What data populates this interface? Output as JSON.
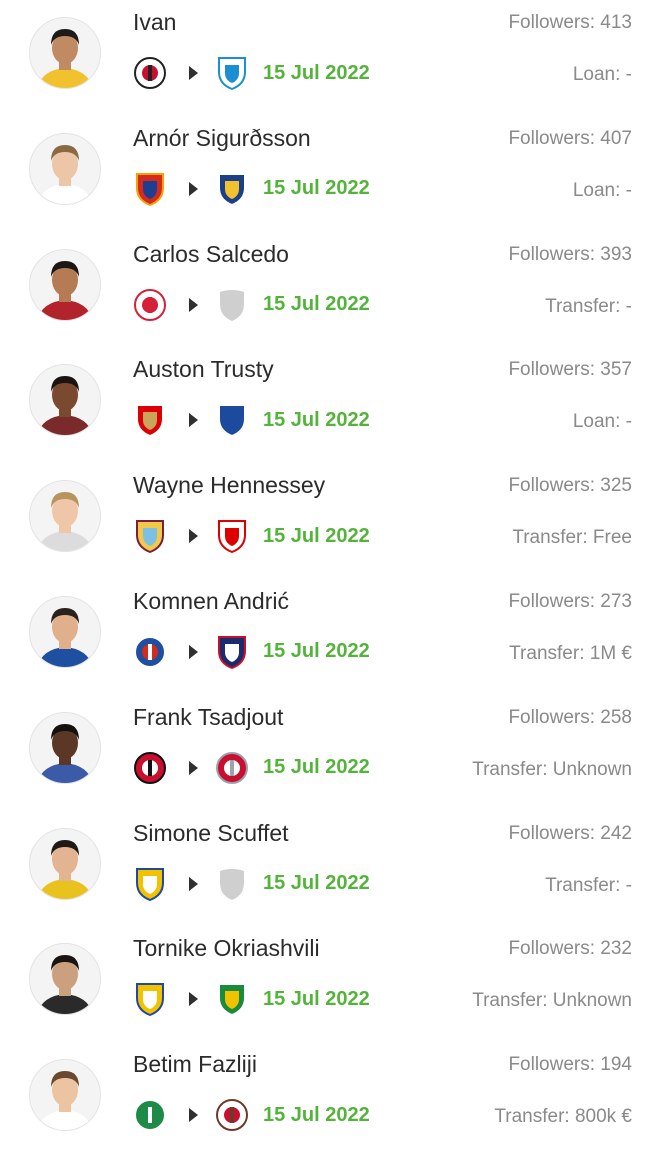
{
  "transfers": [
    {
      "name": "Ivan",
      "followers": "Followers: 413",
      "date": "15 Jul 2022",
      "deal": "Loan: -",
      "skin": "#c08a62",
      "hair": "#1d1a18",
      "shirt": "#f2c12e",
      "from_club": {
        "icon": "corinthians-crest-icon",
        "c1": "#ffffff",
        "c2": "#222222",
        "c3": "#c8102e"
      },
      "to_club": {
        "icon": "zenit-crest-icon",
        "c1": "#ffffff",
        "c2": "#1b8fd3",
        "c3": "#1b8fd3"
      }
    },
    {
      "name": "Arnór Sigurðsson",
      "followers": "Followers: 407",
      "date": "15 Jul 2022",
      "deal": "Loan: -",
      "skin": "#ecc6a6",
      "hair": "#8a6a45",
      "shirt": "#ffffff",
      "from_club": {
        "icon": "cska-crest-icon",
        "c1": "#d52b1e",
        "c2": "#f4a300",
        "c3": "#1e3f8f"
      },
      "to_club": {
        "icon": "norrkoping-crest-icon",
        "c1": "#1c3f8a",
        "c2": "#ffffff",
        "c3": "#f2c12e"
      }
    },
    {
      "name": "Carlos Salcedo",
      "followers": "Followers: 393",
      "date": "15 Jul 2022",
      "deal": "Transfer: -",
      "skin": "#b57b55",
      "hair": "#1a1716",
      "shirt": "#b3232b",
      "from_club": {
        "icon": "toronto-crest-icon",
        "c1": "#ffffff",
        "c2": "#d5203a",
        "c3": "#d5203a"
      },
      "to_club": {
        "icon": "placeholder-shield-icon",
        "c1": "#cfcfcf",
        "c2": "#cfcfcf",
        "c3": "#cfcfcf"
      }
    },
    {
      "name": "Auston Trusty",
      "followers": "Followers: 357",
      "date": "15 Jul 2022",
      "deal": "Loan: -",
      "skin": "#7a4a30",
      "hair": "#1a1512",
      "shirt": "#7a2a2a",
      "from_club": {
        "icon": "arsenal-crest-icon",
        "c1": "#db0007",
        "c2": "#ffffff",
        "c3": "#c9a55a"
      },
      "to_club": {
        "icon": "birmingham-crest-icon",
        "c1": "#1c4a9c",
        "c2": "#ffffff",
        "c3": "#1c4a9c"
      }
    },
    {
      "name": "Wayne Hennessey",
      "followers": "Followers: 325",
      "date": "15 Jul 2022",
      "deal": "Transfer: Free",
      "skin": "#efc7a8",
      "hair": "#b7935e",
      "shirt": "#dcdcdc",
      "from_club": {
        "icon": "burnley-crest-icon",
        "c1": "#f3c94a",
        "c2": "#7a1f3a",
        "c3": "#7dc0e4"
      },
      "to_club": {
        "icon": "nottingham-forest-crest-icon",
        "c1": "#ffffff",
        "c2": "#dd0000",
        "c3": "#dd0000"
      }
    },
    {
      "name": "Komnen Andrić",
      "followers": "Followers: 273",
      "date": "15 Jul 2022",
      "deal": "Transfer: 1M €",
      "skin": "#e0b08c",
      "hair": "#2a221d",
      "shirt": "#1f4fa0",
      "from_club": {
        "icon": "dinamo-zagreb-crest-icon",
        "c1": "#1f4fa0",
        "c2": "#ffffff",
        "c3": "#d52b1e"
      },
      "to_club": {
        "icon": "clermont-crest-icon",
        "c1": "#1c2b6b",
        "c2": "#c8102e",
        "c3": "#ffffff"
      }
    },
    {
      "name": "Frank Tsadjout",
      "followers": "Followers: 258",
      "date": "15 Jul 2022",
      "deal": "Transfer: Unknown",
      "skin": "#5b3826",
      "hair": "#141110",
      "shirt": "#3b5aa7",
      "from_club": {
        "icon": "ac-milan-crest-icon",
        "c1": "#c8102e",
        "c2": "#111111",
        "c3": "#ffffff"
      },
      "to_club": {
        "icon": "cremonese-crest-icon",
        "c1": "#c8102e",
        "c2": "#9aa3b2",
        "c3": "#ffffff"
      }
    },
    {
      "name": "Simone Scuffet",
      "followers": "Followers: 242",
      "date": "15 Jul 2022",
      "deal": "Transfer: -",
      "skin": "#e2b491",
      "hair": "#1f1a17",
      "shirt": "#e9c21d",
      "from_club": {
        "icon": "apoel-crest-icon",
        "c1": "#f2c200",
        "c2": "#1e4aa0",
        "c3": "#ffffff"
      },
      "to_club": {
        "icon": "placeholder-shield-icon",
        "c1": "#cfcfcf",
        "c2": "#cfcfcf",
        "c3": "#cfcfcf"
      }
    },
    {
      "name": "Tornike Okriashvili",
      "followers": "Followers: 232",
      "date": "15 Jul 2022",
      "deal": "Transfer: Unknown",
      "skin": "#caa07f",
      "hair": "#1a1512",
      "shirt": "#2a2a2a",
      "from_club": {
        "icon": "apoel-crest-icon",
        "c1": "#f2c200",
        "c2": "#1e4aa0",
        "c3": "#ffffff"
      },
      "to_club": {
        "icon": "jeonbuk-crest-icon",
        "c1": "#1a8a3c",
        "c2": "#ffffff",
        "c3": "#f2c200"
      }
    },
    {
      "name": "Betim Fazliji",
      "followers": "Followers: 194",
      "date": "15 Jul 2022",
      "deal": "Transfer: 800k €",
      "skin": "#ecc4a2",
      "hair": "#6a4a2e",
      "shirt": "#ffffff",
      "from_club": {
        "icon": "st-gallen-crest-icon",
        "c1": "#1e8a48",
        "c2": "#ffffff",
        "c3": "#1e8a48"
      },
      "to_club": {
        "icon": "st-pauli-crest-icon",
        "c1": "#ffffff",
        "c2": "#6b3a2a",
        "c3": "#c8102e"
      }
    }
  ]
}
